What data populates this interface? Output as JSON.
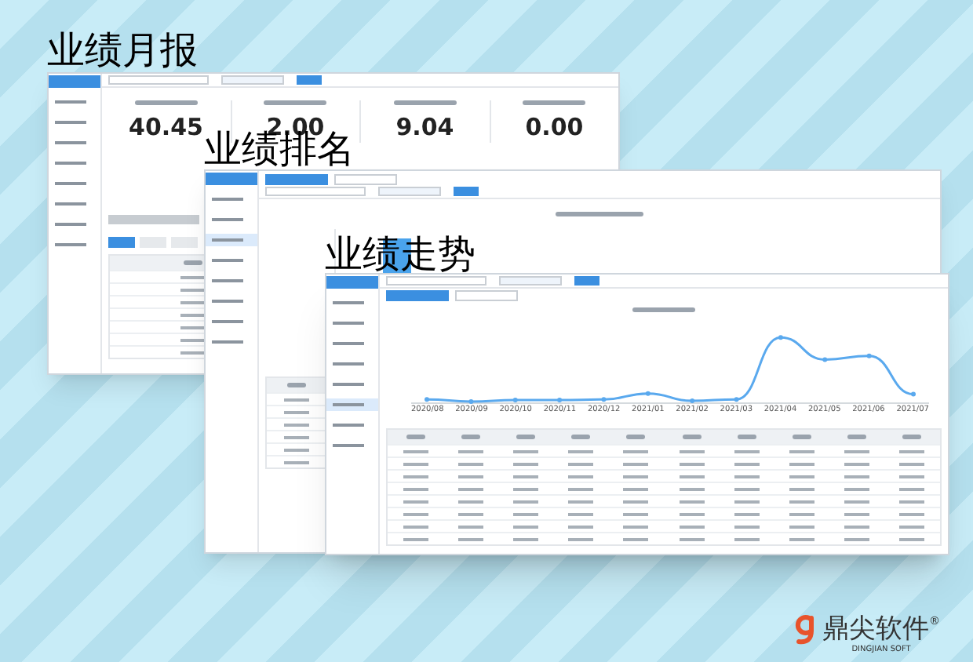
{
  "panels": [
    {
      "kind": "monthly",
      "title": "业绩月报",
      "stats": [
        {
          "value": "40.45"
        },
        {
          "value": "2.00"
        },
        {
          "value": "9.04"
        },
        {
          "value": "0.00"
        }
      ],
      "tabs": [
        {
          "selected": true
        },
        {
          "selected": false
        },
        {
          "selected": false
        }
      ],
      "menu": [
        {
          "selected": false
        },
        {
          "selected": false
        },
        {
          "selected": false
        },
        {
          "selected": false
        },
        {
          "selected": false
        },
        {
          "selected": false
        },
        {
          "selected": false
        },
        {
          "selected": false
        }
      ]
    },
    {
      "kind": "ranking",
      "title": "业绩排名",
      "menu": [
        {
          "selected": false
        },
        {
          "selected": false
        },
        {
          "selected": true
        },
        {
          "selected": false
        },
        {
          "selected": false
        },
        {
          "selected": false
        },
        {
          "selected": false
        },
        {
          "selected": false
        }
      ]
    },
    {
      "kind": "trend",
      "title": "业绩走势",
      "x_labels": [
        "2020/08",
        "2020/09",
        "2020/10",
        "2020/11",
        "2020/12",
        "2021/01",
        "2021/02",
        "2021/03",
        "2021/04",
        "2021/05",
        "2021/06",
        "2021/07"
      ],
      "menu": [
        {
          "selected": false
        },
        {
          "selected": false
        },
        {
          "selected": false
        },
        {
          "selected": false
        },
        {
          "selected": false
        },
        {
          "selected": true
        },
        {
          "selected": false
        },
        {
          "selected": false
        }
      ]
    }
  ],
  "logo": {
    "name": "鼎尖软件",
    "mark": "®",
    "subtitle": "DINGJIAN SOFT"
  }
}
